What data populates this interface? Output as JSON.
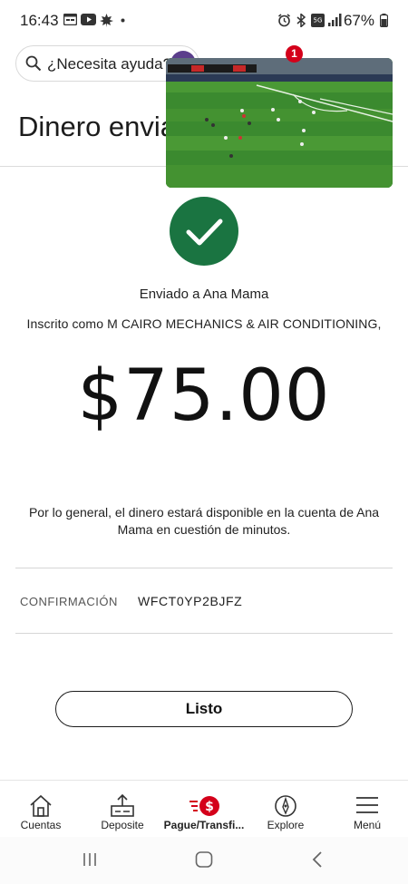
{
  "status_bar": {
    "time": "16:43",
    "battery": "67%"
  },
  "header": {
    "search_placeholder": "¿Necesita ayuda?",
    "notification_count": "1",
    "title": "Dinero envia"
  },
  "confirmation": {
    "sent_to": "Enviado a Ana Mama",
    "registered_as": "Inscrito como M CAIRO MECHANICS & AIR CONDITIONING,",
    "amount": "$75.00",
    "availability_note": "Por lo general, el dinero estará disponible en la cuenta de Ana Mama en cuestión de minutos.",
    "confirmation_label": "CONFIRMACIÓN",
    "confirmation_code": "WFCT0YP2BJFZ",
    "done_button": "Listo"
  },
  "bottom_nav": {
    "items": [
      {
        "label": "Cuentas",
        "icon": "home-icon"
      },
      {
        "label": "Deposite",
        "icon": "deposit-icon"
      },
      {
        "label": "Pague/Transfi...",
        "icon": "pay-transfer-icon",
        "active": true
      },
      {
        "label": "Explore",
        "icon": "compass-icon"
      },
      {
        "label": "Menú",
        "icon": "menu-icon"
      }
    ]
  },
  "colors": {
    "success_green": "#1a7441",
    "brand_red": "#d4001a",
    "text": "#1c1c1c"
  }
}
